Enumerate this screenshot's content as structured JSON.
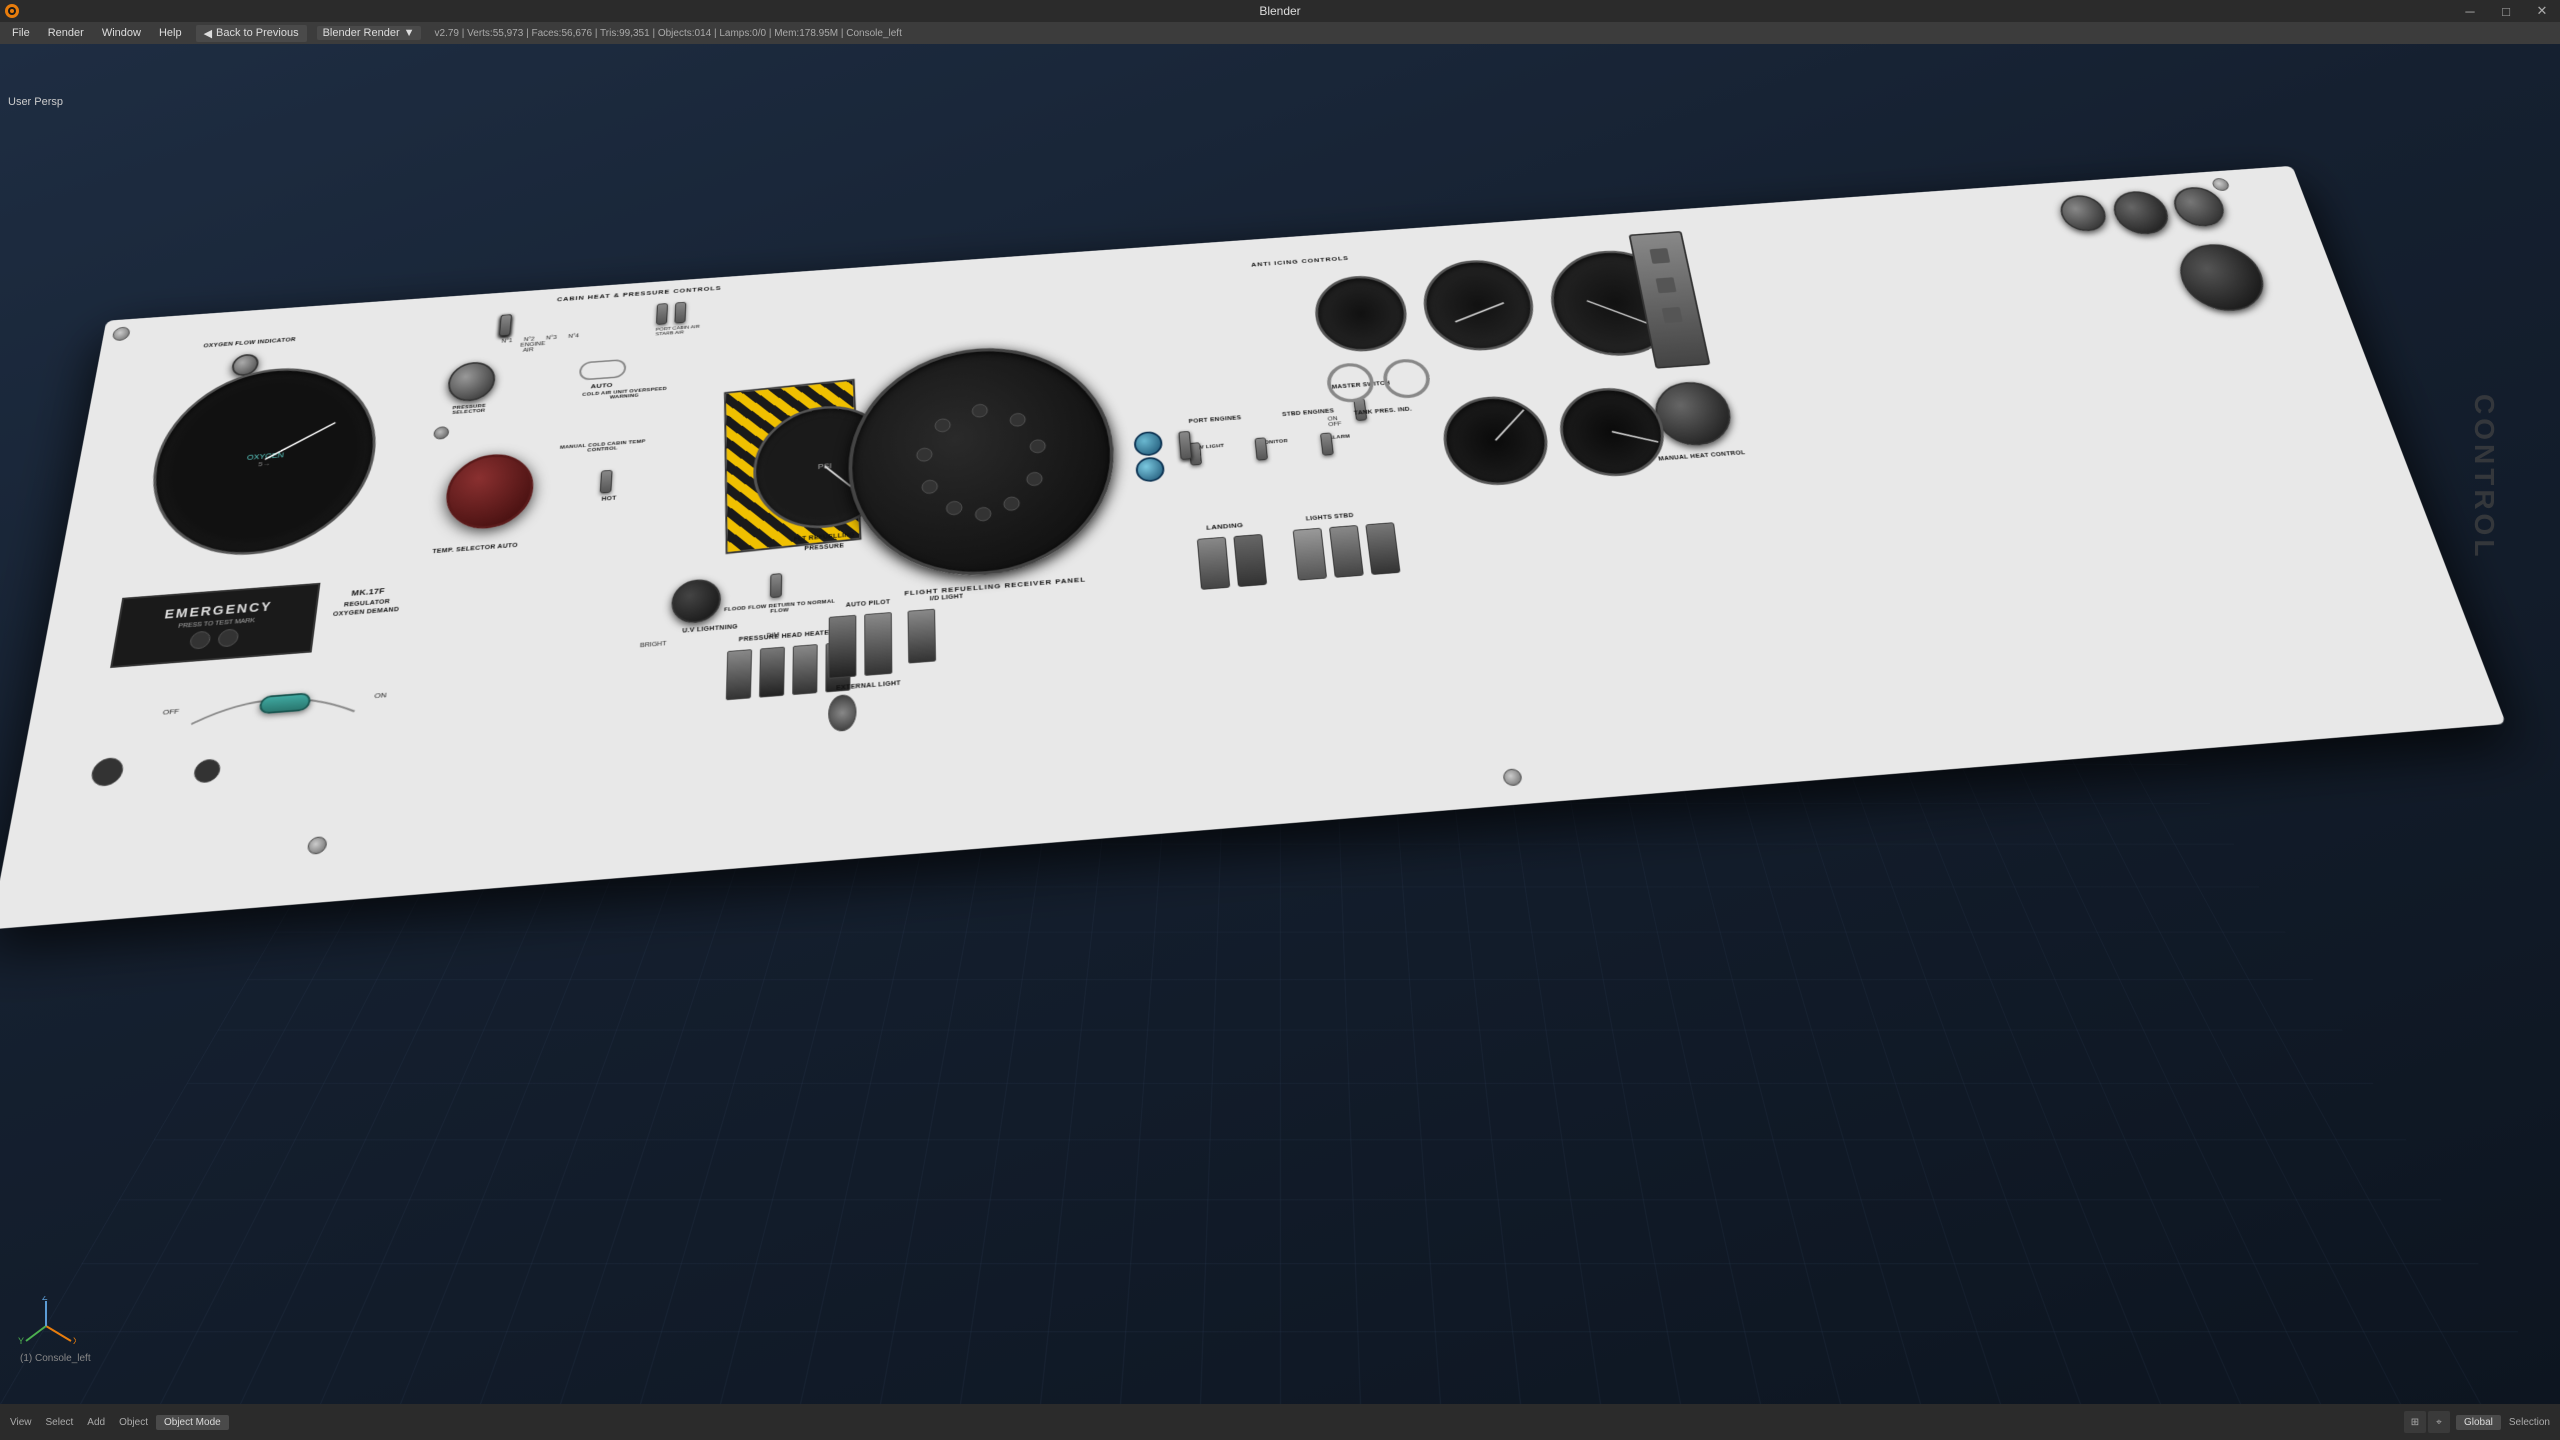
{
  "titlebar": {
    "title": "Blender",
    "window_controls": {
      "minimize": "—",
      "maximize": "□",
      "close": "✕"
    }
  },
  "menubar": {
    "back_label": "Back to Previous",
    "menu_items": [
      "File",
      "Render",
      "Window",
      "Help"
    ],
    "render_engine": "Blender Render",
    "stats": "v2.79 | Verts:55,973 | Faces:56,676 | Tris:99,351 | Objects:014 | Lamps:0/0 | Mem:178.95M | Console_left"
  },
  "viewport": {
    "user_persp": "User Persp"
  },
  "panel": {
    "labels": {
      "cabin_heat": "CABIN HEAT & PRESSURE CONTROLS",
      "pressure_selector": "PRESSURE SELECTOR",
      "oxygen_flow": "OXYGEN FLOW INDICATOR",
      "oxygen": "OXYGEN",
      "mk17f": "MK.17F",
      "emergency": "EMERGENCY",
      "press_to_test": "PRESS TO TEST MARK",
      "regulator": "REGULATOR",
      "oxygen_demand": "OXYGEN DEMAND",
      "temp_selector": "TEMP. SELECTOR AUTO",
      "auto": "AUTO",
      "cold_air_unit": "COLD AIR UNIT OVERSPEED WARNING",
      "manual_cold": "MANUAL COLD CABIN TEMP CONTROL",
      "hot": "HOT",
      "uv_lightning": "U.V LIGHTNING",
      "bright": "BRIGHT",
      "dim": "DIM",
      "flood_flow": "FLOOD FLOW RETURN TO NORMAL FLOW",
      "pressure_head": "PRESSURE HEAD HEATERS",
      "auto_pilot": "AUTO PILOT",
      "external_light": "EXTERNAL LIGHT",
      "landing_light": "LANDING LIGHT",
      "id_light": "I/D LIGHT",
      "lights_stbd": "LIGHTS STBD",
      "nav_light": "NAV LIGHT",
      "monitor": "MONITOR",
      "alarm": "ALARM",
      "flight_refuelling": "FLIGHT REFUELLING RECEIVER PANEL",
      "flt_refuelling": "FLT REFUELLING",
      "pressure": "PRESSURE",
      "psi": "PSI",
      "manual_heat": "MANUAL HEAT CONTROL",
      "port_engines": "PORT ENGINES",
      "stbd_engines": "STBD ENGINES",
      "anti_icing": "ANTI ICING CONTROLS",
      "tank_pres": "TANK PRES. IND.",
      "master_switch": "MASTER SWITCH",
      "landing": "LANDING",
      "nav": "NAV",
      "control_text": "COnTRol"
    }
  },
  "statusbar": {
    "items": [
      "View",
      "Select",
      "Add",
      "Object"
    ],
    "mode": "Object Mode",
    "global": "Global",
    "selection": "Selection",
    "console": "(1) Console_left"
  },
  "axes": {
    "x": "X",
    "y": "Y",
    "z": "Z"
  }
}
